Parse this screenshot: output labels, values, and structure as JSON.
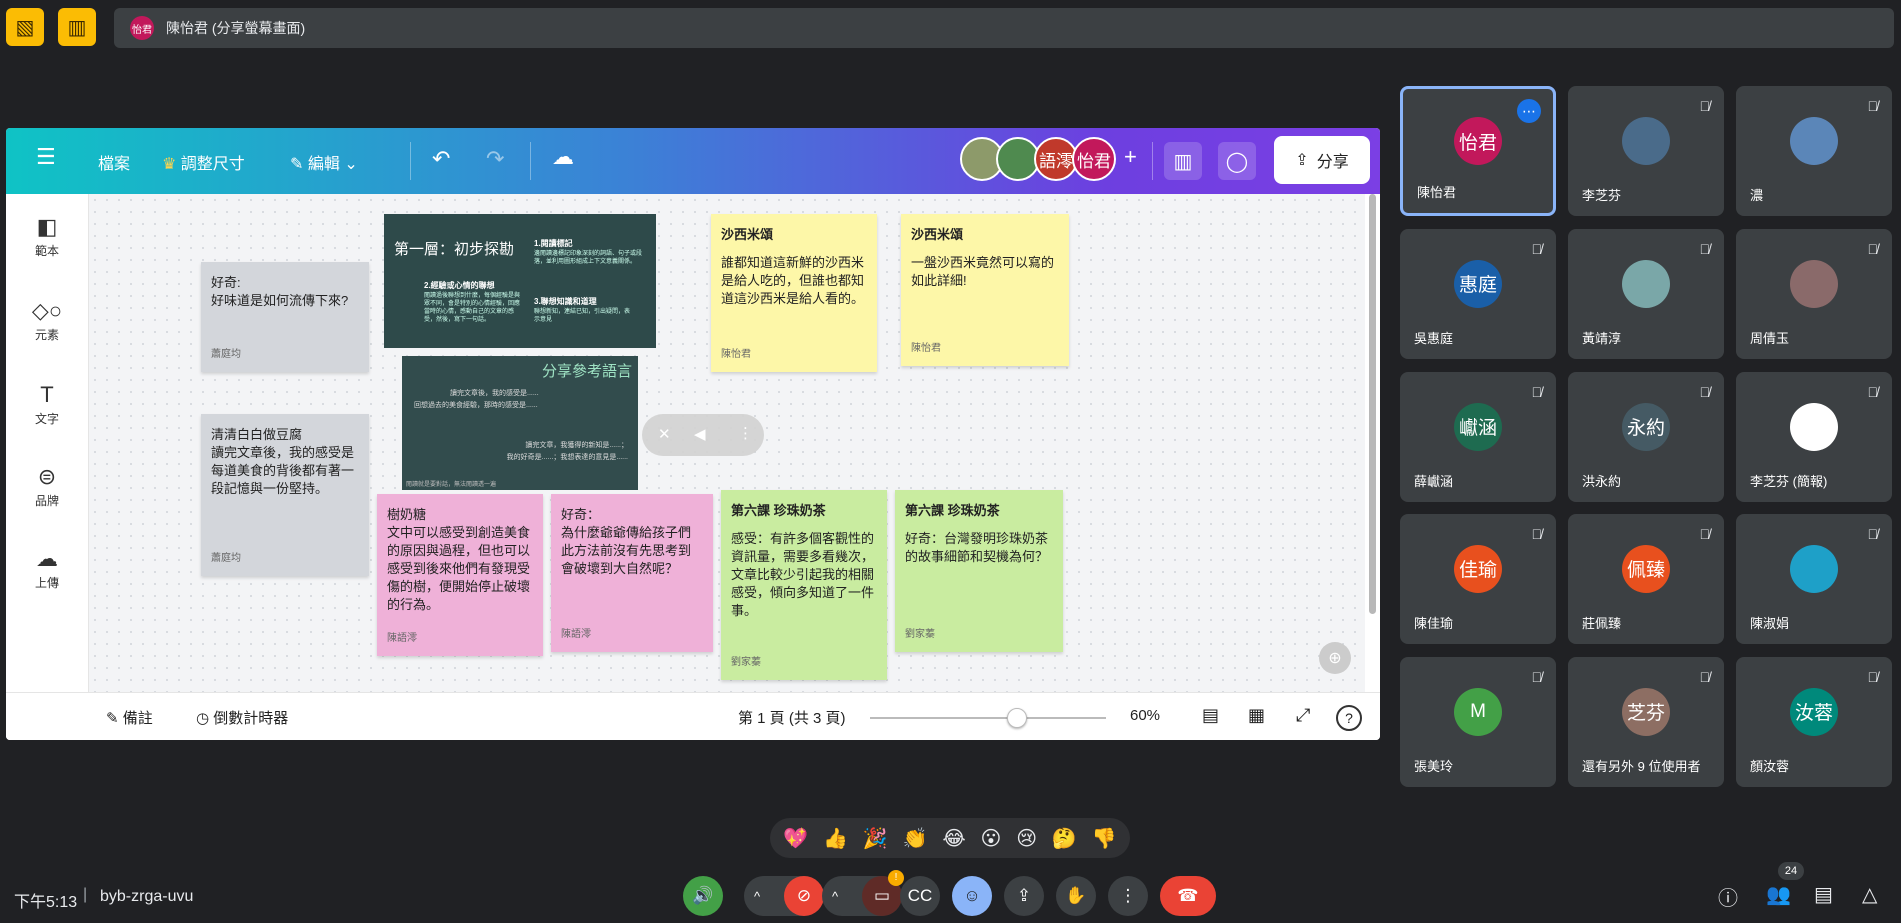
{
  "top": {
    "presenter_avatar": "怡君",
    "presenter_label": "陳怡君 (分享螢幕畫面)"
  },
  "canva": {
    "menu": {
      "file": "檔案",
      "resize": "調整尺寸",
      "edit": "編輯",
      "share": "分享"
    },
    "avatars": [
      "語澪",
      "怡君"
    ],
    "sidebar": [
      {
        "label": "範本",
        "icon": "template-icon"
      },
      {
        "label": "元素",
        "icon": "elements-icon"
      },
      {
        "label": "文字",
        "icon": "text-icon"
      },
      {
        "label": "品牌",
        "icon": "brand-icon"
      },
      {
        "label": "上傳",
        "icon": "upload-icon"
      }
    ],
    "notes": [
      {
        "title": "好奇:",
        "body": "好味道是如何流傳下來?",
        "author": "蕭庭均",
        "color": "#d3d6db"
      },
      {
        "title": "",
        "body": "清清白白做豆腐\n讀完文章後，我的感受是每道美食的背後都有著一段記憶與一份堅持。",
        "author": "蕭庭均",
        "color": "#d3d6db"
      },
      {
        "title": "樹奶糖",
        "body": "文中可以感受到創造美食的原因與過程，但也可以感受到後來他們有發現受傷的樹，便開始停止破壞的行為。",
        "author": "陳語澪",
        "color": "#efb1d8"
      },
      {
        "title": "好奇：",
        "body": "為什麼爺爺傳給孩子們此方法前沒有先思考到會破壞到大自然呢？",
        "author": "陳語澪",
        "color": "#efb1d8"
      },
      {
        "title": "沙西米頌",
        "body": "誰都知道這新鮮的沙西米是給人吃的，但誰也都知道這沙西米是給人看的。",
        "author": "陳怡君",
        "color": "#fdf7a8"
      },
      {
        "title": "沙西米頌",
        "body": "一盤沙西米竟然可以寫的如此詳細!",
        "author": "陳怡君",
        "color": "#fdf7a8"
      },
      {
        "title": "第六課 珍珠奶茶",
        "body": "感受：有許多個客觀性的資訊量，需要多看幾次，文章比較少引起我的相關感受，傾向多知道了一件事。",
        "author": "劉家蓁",
        "color": "#c9eca0"
      },
      {
        "title": "第六課 珍珠奶茶",
        "body": "好奇：台灣發明珍珠奶茶的故事細節和契機為何？",
        "author": "劉家蓁",
        "color": "#c9eca0"
      }
    ],
    "slide1": {
      "title": "第一層：初步探勘",
      "h1": "1.閱讀標記",
      "h2": "2.經驗或心情的聯想",
      "h3": "3.聯想知識和道理",
      "t1": "邊閱讀邊標記印象深刻的詞語、句子或段落，並利用圖形組成上下文意義關係。",
      "t2": "閱讀過後聯想到什麼，每個經驗是與眾不同，會是特別的心情經驗，回應當時的心情，感動自己的文章的感受，然後，寫下一句話。",
      "t3": "聯想新知，連結已知，引出疑問，表示意見"
    },
    "slide2": {
      "title": "分享參考語言",
      "t1": "讀完文章後，我的感受是......",
      "t2": "回想過去的美食經驗，那時的感受是......",
      "t3": "讀完文章，我獲得的新知是......；",
      "t4": "我的好奇是......；我想表達的意見是......",
      "footer": "閱讀就是要對話，無法閱讀透一遍"
    },
    "bottom": {
      "notes": "備註",
      "timer": "倒數計時器",
      "page": "第 1 頁 (共 3 頁)",
      "zoom": "60%",
      "zoom_level": 0.62
    }
  },
  "participants": [
    {
      "name": "陳怡君",
      "avatar": "怡君",
      "color": "#c2185b",
      "active": true
    },
    {
      "name": "李芝芬",
      "avatar": "",
      "color": "#4a6b8a"
    },
    {
      "name": "濃",
      "avatar": "",
      "color": "#5b86b8"
    },
    {
      "name": "吳惠庭",
      "avatar": "惠庭",
      "color": "#1a5fa8"
    },
    {
      "name": "黃靖淳",
      "avatar": "",
      "color": "#7aa7a8"
    },
    {
      "name": "周倩玉",
      "avatar": "",
      "color": "#8a6a6a"
    },
    {
      "name": "薛巘涵",
      "avatar": "巘涵",
      "color": "#1e6b50"
    },
    {
      "name": "洪永約",
      "avatar": "永約",
      "color": "#455a64"
    },
    {
      "name": "李芝芬 (簡報)",
      "avatar": "",
      "color": "#ffffff"
    },
    {
      "name": "陳佳瑜",
      "avatar": "佳瑜",
      "color": "#e8501e"
    },
    {
      "name": "莊佩臻",
      "avatar": "佩臻",
      "color": "#e8501e"
    },
    {
      "name": "陳淑娟",
      "avatar": "",
      "color": "#1ea0c8"
    },
    {
      "name": "張美玲",
      "avatar": "M",
      "color": "#43a047"
    },
    {
      "name": "還有另外 9 位使用者",
      "avatar": "芝芬",
      "color": "#8d6e63"
    },
    {
      "name": "顏汝蓉",
      "avatar": "汝蓉",
      "color": "#00897b"
    }
  ],
  "reactions": [
    "💖",
    "👍",
    "🎉",
    "👏",
    "😂",
    "😮",
    "😢",
    "🤔",
    "👎"
  ],
  "footer": {
    "time": "下午5:13",
    "meeting_code": "byb-zrga-uvu",
    "people_count": "24",
    "camera_badge": "!"
  }
}
